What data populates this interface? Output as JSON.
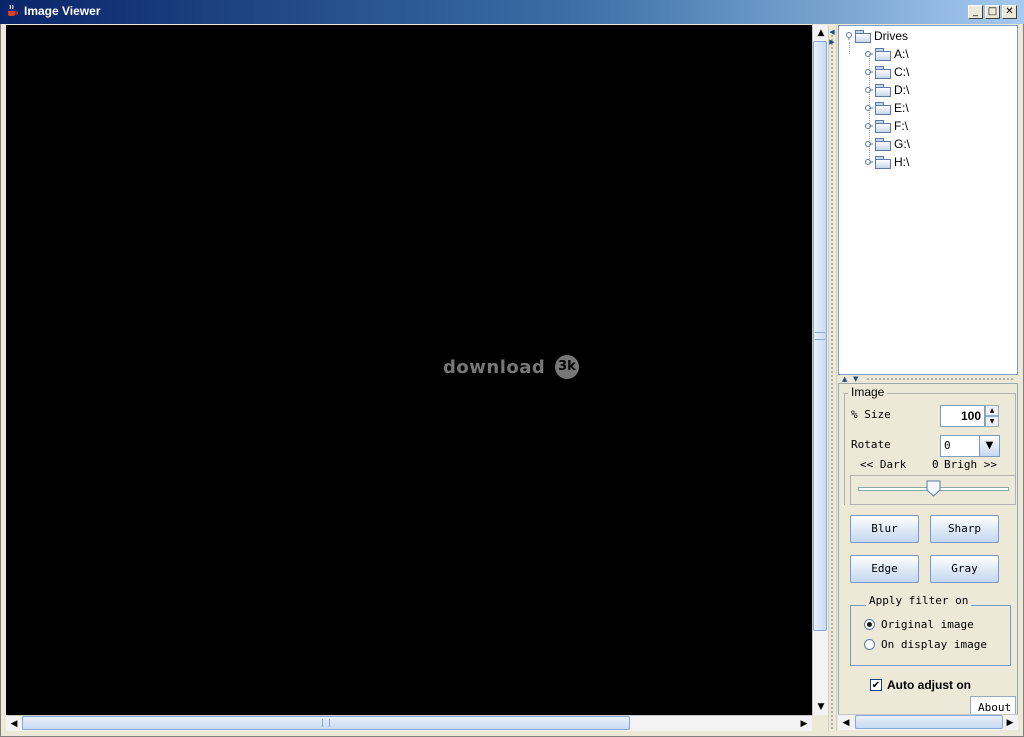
{
  "window": {
    "title": "Image Viewer",
    "app_icon": "java-cup-icon",
    "controls": [
      "minimize",
      "maximize",
      "close"
    ]
  },
  "watermark": {
    "text": "download",
    "badge": "3k"
  },
  "tree": {
    "root": "Drives",
    "items": [
      "A:\\",
      "C:\\",
      "D:\\",
      "E:\\",
      "F:\\",
      "G:\\",
      "H:\\"
    ]
  },
  "image_panel": {
    "group_title": "Image",
    "size_label": "% Size",
    "size_value": "100",
    "rotate_label": "Rotate",
    "rotate_value": "0",
    "dark_label": "<< Dark",
    "bright_label": "Brigh >>",
    "brightness_value": "0",
    "brightness_level": 0.5,
    "buttons": {
      "blur": "Blur",
      "sharp": "Sharp",
      "edge": "Edge",
      "gray": "Gray"
    },
    "apply_group_title": "Apply filter on",
    "radio_original": "Original image",
    "radio_display": "On display image",
    "auto_adjust": "Auto adjust on",
    "about_tab": "About"
  },
  "colors": {
    "title_bar": "#0a246a",
    "accent": "#7a98c6",
    "canvas": "#000000"
  }
}
